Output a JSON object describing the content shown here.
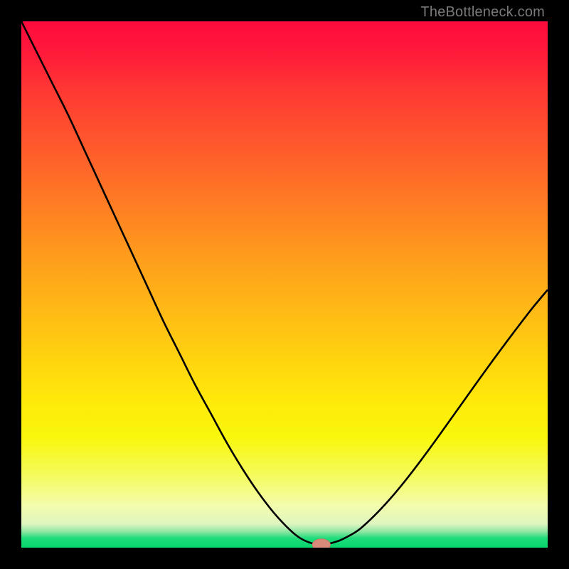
{
  "watermark": "TheBottleneck.com",
  "colors": {
    "curve_stroke": "#000000",
    "marker_fill": "#d98b7a",
    "marker_stroke": "#c97866"
  },
  "chart_data": {
    "type": "line",
    "title": "",
    "xlabel": "",
    "ylabel": "",
    "xlim": [
      0,
      100
    ],
    "ylim": [
      0,
      100
    ],
    "x": [
      0,
      3,
      6,
      9,
      12,
      15,
      18,
      21,
      24,
      27,
      30,
      33,
      36,
      39,
      42,
      45,
      48,
      51,
      53,
      55,
      57,
      59,
      61,
      64,
      67,
      70,
      73,
      76,
      79,
      82,
      85,
      88,
      91,
      94,
      97,
      100
    ],
    "values": [
      100,
      94,
      88,
      82,
      75.5,
      69,
      62.5,
      56,
      49.5,
      43,
      37,
      31,
      25.5,
      20,
      15,
      10.5,
      6.6,
      3.4,
      1.8,
      0.9,
      0.55,
      0.9,
      1.6,
      3.3,
      6.0,
      9.2,
      12.8,
      16.7,
      20.8,
      25.0,
      29.2,
      33.4,
      37.5,
      41.5,
      45.4,
      49.0
    ],
    "marker": {
      "x": 57,
      "y": 0.55,
      "rx": 1.7,
      "ry": 1.1
    }
  }
}
